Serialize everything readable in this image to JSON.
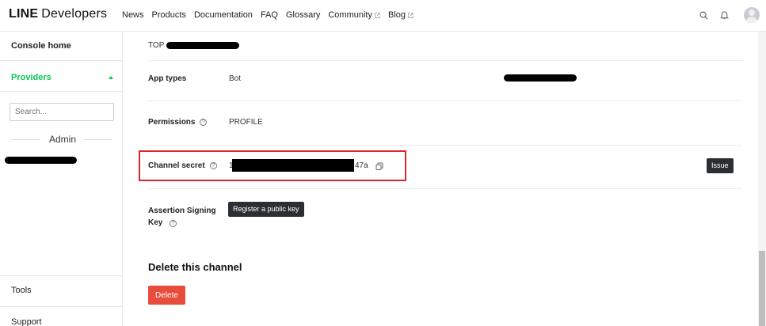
{
  "header": {
    "logo_bold": "LINE",
    "logo_rest": "Developers",
    "nav": [
      {
        "label": "News",
        "external": false
      },
      {
        "label": "Products",
        "external": false
      },
      {
        "label": "Documentation",
        "external": false
      },
      {
        "label": "FAQ",
        "external": false
      },
      {
        "label": "Glossary",
        "external": false
      },
      {
        "label": "Community",
        "external": true
      },
      {
        "label": "Blog",
        "external": true
      }
    ],
    "icons": [
      "search-icon",
      "bell-icon",
      "avatar"
    ]
  },
  "sidebar": {
    "console_home": "Console home",
    "providers": "Providers",
    "search_placeholder": "Search...",
    "admin_label": "Admin",
    "tools": "Tools",
    "support": "Support"
  },
  "main": {
    "breadcrumb": "TOP",
    "app_types_label": "App types",
    "app_types_value": "Bot",
    "permissions_label": "Permissions",
    "permissions_value": "PROFILE",
    "channel_secret_label": "Channel secret",
    "channel_secret_prefix": "1",
    "channel_secret_suffix": "47a",
    "issue_button": "Issue",
    "assertion_label": "Assertion Signing Key",
    "register_button": "Register a public key",
    "delete_section_title": "Delete this channel",
    "delete_button": "Delete"
  },
  "colors": {
    "brand_green": "#06c755",
    "highlight_red": "#d8262e",
    "delete_red": "#e74c3c",
    "dark_button": "#2b2f33"
  }
}
